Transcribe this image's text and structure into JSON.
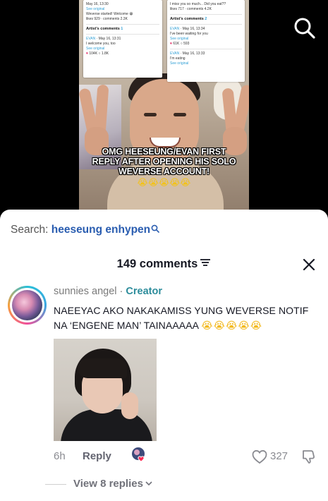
{
  "video": {
    "caption_line1": "OMG HEESEUNG/EVAN FIRST",
    "caption_line2": "REPLY AFTER OPENING HIS SOLO",
    "caption_line3": "WEVERSE ACCOUNT!",
    "caption_emojis": "😭😭😭😭😭",
    "screenshot_left": {
      "top_date": "May 16, 13:30",
      "see_original": "See original",
      "body": "Weverse started! Welcome 😀",
      "stats": "likes 929 · comments 2.3K",
      "section_title": "Artist's comments",
      "section_count": "1",
      "author": "EVAN",
      "author_date": "May 16, 13:31",
      "reply": "I welcome you, too",
      "reply_see_original": "See original",
      "reply_likes": "104K",
      "reply_comments": "1.8K"
    },
    "screenshot_right": {
      "top_text": "I miss you so much... Did you eat??",
      "stats": "likes 717 · comments 4.2K",
      "section_title": "Artist's comments",
      "section_count": "2",
      "author": "EVAN",
      "author_date": "May 16, 13:34",
      "reply1": "I've been waiting for you",
      "reply1_see_original": "See original",
      "reply1_likes": "61K",
      "reply1_comments": "593",
      "author2_date": "May 16, 13:33",
      "reply2": "I'm eating",
      "reply2_see_original": "See original"
    }
  },
  "search": {
    "prefix": "Search:",
    "query": "heeseung enhypen"
  },
  "comments": {
    "count_label": "149 comments"
  },
  "comment": {
    "username": "sunnies angel",
    "separator": " · ",
    "badge": "Creator",
    "text": "NAEEYAC AKO NAKAKAMISS YUNG WEVERSE NOTIF NA ‘ENGENE MAN’ TAINAAAAA",
    "emojis": "😭😭😭😭😭",
    "time": "6h",
    "reply_label": "Reply",
    "likes": "327",
    "view_replies": "View 8 replies"
  },
  "colors": {
    "creator": "#2c8c9b",
    "search_query": "#2a5db0",
    "text": "#161823",
    "muted": "#8a8b91"
  }
}
